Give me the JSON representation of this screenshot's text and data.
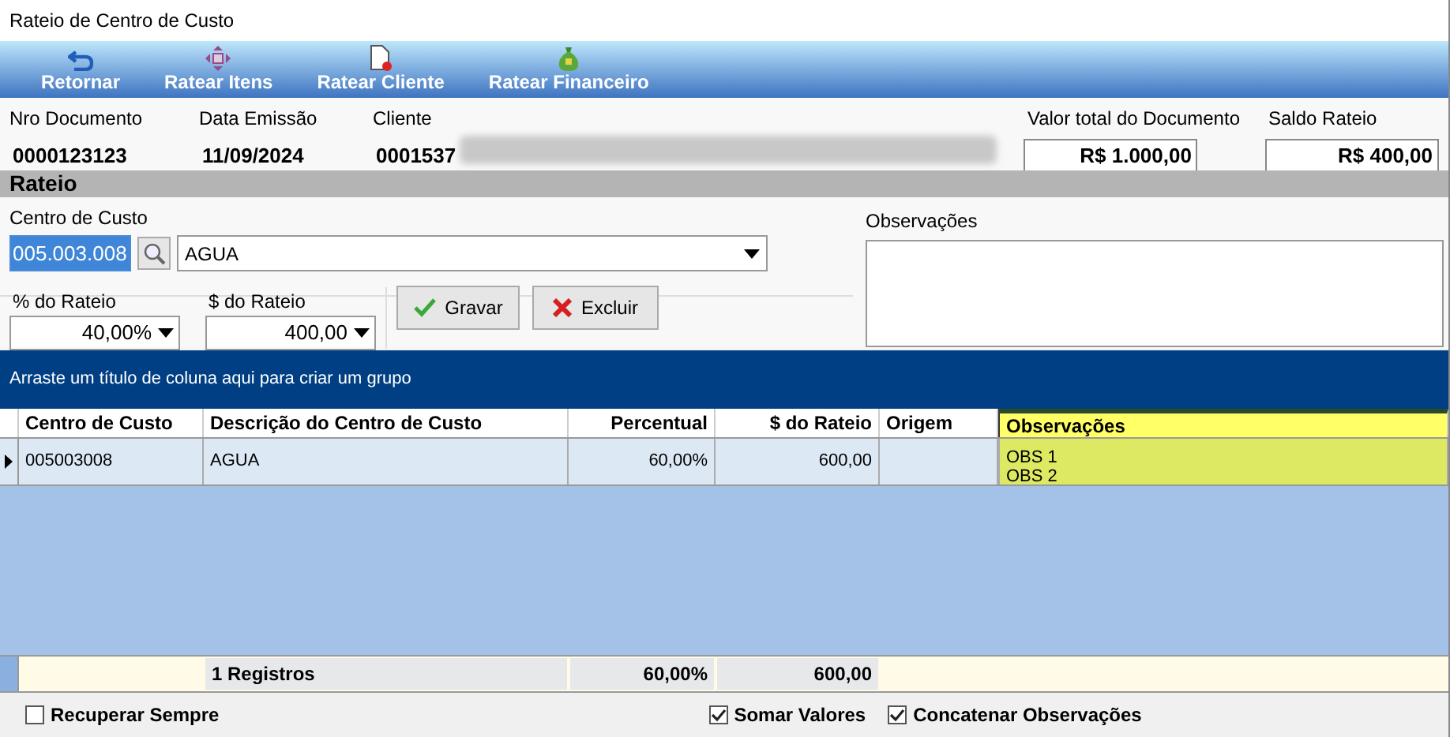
{
  "window": {
    "title": "Rateio de Centro de Custo"
  },
  "toolbar": [
    {
      "kind": "return",
      "label": "Retornar"
    },
    {
      "kind": "move",
      "label": "Ratear Itens"
    },
    {
      "kind": "document",
      "label": "Ratear Cliente"
    },
    {
      "kind": "money",
      "label": "Ratear Financeiro"
    }
  ],
  "header": {
    "fields": [
      {
        "label": "Nro Documento",
        "value": "0000123123"
      },
      {
        "label": "Data Emissão",
        "value": "11/09/2024"
      },
      {
        "label": "Cliente",
        "value": "0001537"
      }
    ],
    "totals": [
      {
        "label": "Valor total do Documento",
        "value": "R$ 1.000,00"
      },
      {
        "label": "Saldo Rateio",
        "value": "R$ 400,00"
      }
    ]
  },
  "section_title": "Rateio",
  "form": {
    "cost_center_label": "Centro de Custo",
    "cost_center_code": "005.003.008",
    "cost_center_name": "AGUA",
    "percent_label": "% do Rateio",
    "percent_value": "40,00%",
    "amount_label": "$ do Rateio",
    "amount_value": "400,00",
    "save_button": "Gravar",
    "delete_button": "Excluir",
    "notes_label": "Observações"
  },
  "group_hint": "Arraste um título de coluna aqui para criar um grupo",
  "table": {
    "columns": [
      {
        "label": "Centro de Custo",
        "kind": "text",
        "highlighted": false
      },
      {
        "label": "Descrição do Centro de Custo",
        "kind": "text",
        "highlighted": false
      },
      {
        "label": "Percentual",
        "kind": "number",
        "highlighted": false
      },
      {
        "label": "$ do Rateio",
        "kind": "number",
        "highlighted": false
      },
      {
        "label": "Origem",
        "kind": "text",
        "highlighted": false
      },
      {
        "label": "Observações",
        "kind": "text",
        "highlighted": true
      }
    ],
    "rows": [
      {
        "selected": true,
        "cells": [
          "005003008",
          "AGUA",
          "60,00%",
          "600,00",
          "",
          [
            "OBS 1",
            "OBS 2"
          ]
        ]
      }
    ],
    "footer": {
      "count": "1 Registros",
      "percent": "60,00%",
      "amount": "600,00"
    }
  },
  "options": [
    {
      "label": "Recuperar Sempre",
      "checked": false
    },
    {
      "label": "Somar Valores",
      "checked": true
    },
    {
      "label": "Concatenar Observações",
      "checked": true
    }
  ]
}
